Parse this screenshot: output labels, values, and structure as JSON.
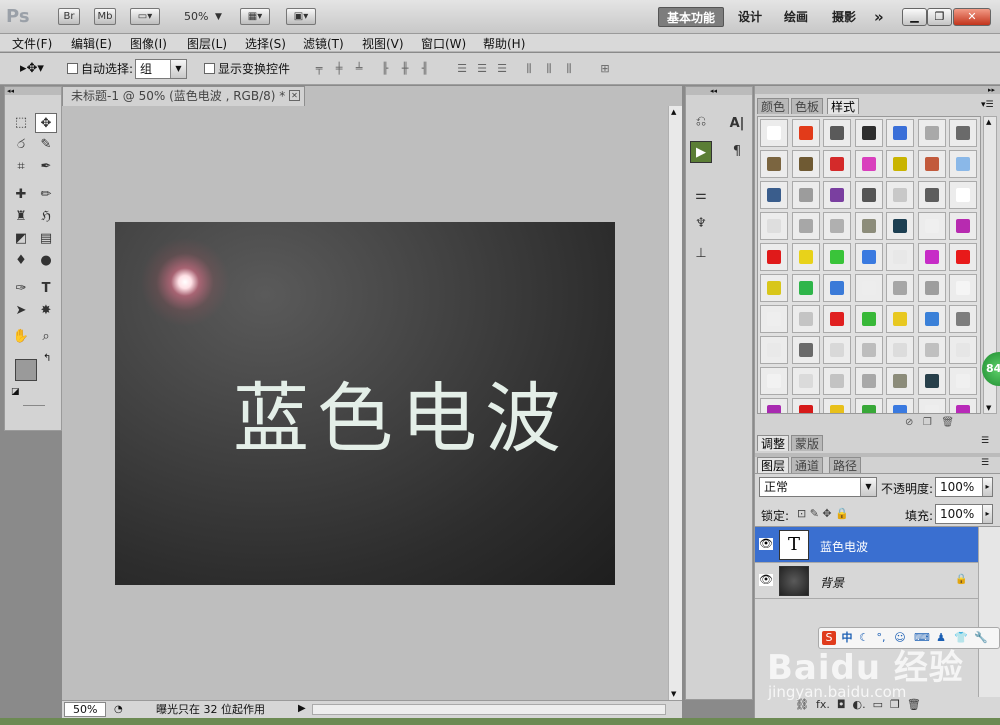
{
  "titlebar": {
    "logo": "Ps",
    "bridge": "Br",
    "minibridge": "Mb",
    "zoom": "50%",
    "workspaces": [
      "基本功能",
      "设计",
      "绘画",
      "摄影"
    ],
    "more": "»"
  },
  "menubar": [
    "文件(F)",
    "编辑(E)",
    "图像(I)",
    "图层(L)",
    "选择(S)",
    "滤镜(T)",
    "视图(V)",
    "窗口(W)",
    "帮助(H)"
  ],
  "optionsbar": {
    "auto_select_label": "自动选择:",
    "auto_select_value": "组",
    "show_transform_label": "显示变换控件"
  },
  "document": {
    "tab_title": "未标题-1 @ 50% (蓝色电波 , RGB/8) *",
    "canvas_text": "蓝色电波",
    "zoom": "50%",
    "status": "曝光只在 32 位起作用"
  },
  "styles_panel": {
    "tabs": [
      "颜色",
      "色板",
      "样式"
    ],
    "active_tab": "样式",
    "swatches": [
      [
        "#ffffff",
        "#e23b1a",
        "#5a5a5a",
        "#2e2e2e",
        "#3a6fd8",
        "#a9a9a9",
        "#6a6a6a"
      ],
      [
        "#7b6540",
        "#6f5a33",
        "#d42a2a",
        "#d93fbd",
        "#c9b400",
        "#c25a3c",
        "#8ab8e8"
      ],
      [
        "#3a5d8c",
        "#9c9c9c",
        "#7a3fa0",
        "#555555",
        "#c8c8c8",
        "#5d5d5d",
        "#ffffff"
      ],
      [
        "#dedede",
        "#a7a7a7",
        "#b0b0b0",
        "#8c8c7a",
        "#1d3f52",
        "#efefef",
        "#b72bb0"
      ],
      [
        "#e01a1a",
        "#e8d21a",
        "#3ac43a",
        "#3a7ae0",
        "#e8e8e8",
        "#c72cc7",
        "#e81a1a"
      ],
      [
        "#d8c61a",
        "#2fb54a",
        "#3a7ad8",
        "#ededed",
        "#a6a6a6",
        "#9e9e9e",
        "#f5f5f5"
      ],
      [
        "#eeeeee",
        "#c4c4c4",
        "#e02020",
        "#38b838",
        "#e8c820",
        "#3a80d8",
        "#7d7d7d"
      ],
      [
        "#e9e9e9",
        "#6a6a6a",
        "#d8d8d8",
        "#bdbdbd",
        "#dcdcdc",
        "#c0c0c0",
        "#e6e6e6"
      ],
      [
        "#f2f2f2",
        "#dadada",
        "#c3c3c3",
        "#a8a8a8",
        "#8c8c7a",
        "#273f4a",
        "#f0f0f0"
      ],
      [
        "#a82ab0",
        "#d61a1a",
        "#e8c01a",
        "#38a838",
        "#3a7ae0",
        "#eeeeee",
        "#b82ab8"
      ]
    ]
  },
  "adjust_panel": {
    "tabs": [
      "调整",
      "蒙版"
    ]
  },
  "layers_panel": {
    "tabs": [
      "图层",
      "通道",
      "路径"
    ],
    "blend_mode": "正常",
    "opacity_label": "不透明度:",
    "opacity": "100%",
    "lock_label": "锁定:",
    "fill_label": "填充:",
    "fill": "100%",
    "layers": [
      {
        "name": "蓝色电波",
        "type": "text",
        "selected": true
      },
      {
        "name": "背景",
        "type": "image",
        "selected": false
      }
    ]
  },
  "overlay": {
    "badge": "84",
    "ime_label": "中",
    "watermark": "Baidu 经验",
    "watermark_url": "jingyan.baidu.com"
  }
}
